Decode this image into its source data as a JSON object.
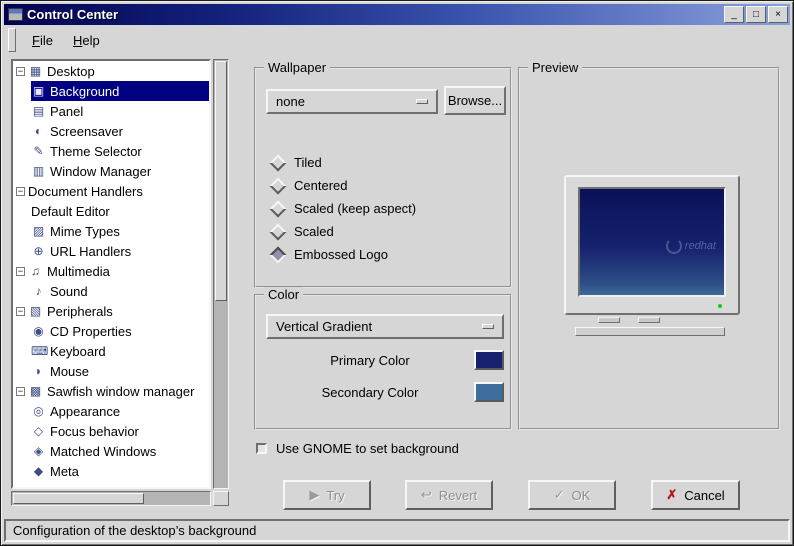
{
  "window": {
    "title": "Control Center",
    "buttons": [
      {
        "name": "minimize",
        "glyph": "_"
      },
      {
        "name": "maximize",
        "glyph": "□"
      },
      {
        "name": "close",
        "glyph": "×"
      }
    ]
  },
  "menubar": {
    "items": [
      {
        "label": "File"
      },
      {
        "label": "Help"
      }
    ]
  },
  "tree": {
    "items": [
      {
        "label": "Desktop",
        "level": 0,
        "expanded": true,
        "glyph": "▦"
      },
      {
        "label": "Background",
        "level": 1,
        "selected": true,
        "glyph": "▣"
      },
      {
        "label": "Panel",
        "level": 1,
        "glyph": "▤"
      },
      {
        "label": "Screensaver",
        "level": 1,
        "glyph": "◐"
      },
      {
        "label": "Theme Selector",
        "level": 1,
        "glyph": "✎"
      },
      {
        "label": "Window Manager",
        "level": 1,
        "glyph": "▥"
      },
      {
        "label": "Document Handlers",
        "level": 0,
        "expanded": true
      },
      {
        "label": "Default Editor",
        "level": 1
      },
      {
        "label": "Mime Types",
        "level": 1,
        "glyph": "▨"
      },
      {
        "label": "URL Handlers",
        "level": 1,
        "glyph": "⊕"
      },
      {
        "label": "Multimedia",
        "level": 0,
        "expanded": true,
        "glyph": "♫"
      },
      {
        "label": "Sound",
        "level": 1,
        "glyph": "♪"
      },
      {
        "label": "Peripherals",
        "level": 0,
        "expanded": true,
        "glyph": "▧"
      },
      {
        "label": "CD Properties",
        "level": 1,
        "glyph": "◉"
      },
      {
        "label": "Keyboard",
        "level": 1,
        "glyph": "⌨"
      },
      {
        "label": "Mouse",
        "level": 1,
        "glyph": "◗"
      },
      {
        "label": "Sawfish window manager",
        "level": 0,
        "expanded": true,
        "glyph": "▩"
      },
      {
        "label": "Appearance",
        "level": 1,
        "glyph": "◎"
      },
      {
        "label": "Focus behavior",
        "level": 1,
        "glyph": "◇"
      },
      {
        "label": "Matched Windows",
        "level": 1,
        "glyph": "◈"
      },
      {
        "label": "Meta",
        "level": 1,
        "glyph": "◆"
      }
    ]
  },
  "wallpaper": {
    "group_title": "Wallpaper",
    "file_dropdown_value": "none",
    "browse_label": "Browse...",
    "options": [
      {
        "label": "Tiled",
        "selected": false
      },
      {
        "label": "Centered",
        "selected": false
      },
      {
        "label": "Scaled (keep aspect)",
        "selected": false
      },
      {
        "label": "Scaled",
        "selected": false
      },
      {
        "label": "Embossed Logo",
        "selected": true
      }
    ]
  },
  "color": {
    "group_title": "Color",
    "gradient_dropdown_value": "Vertical Gradient",
    "primary_label": "Primary Color",
    "primary_color": "#182070",
    "secondary_label": "Secondary Color",
    "secondary_color": "#3e6e9e"
  },
  "preview": {
    "group_title": "Preview",
    "logo_text": "redhat"
  },
  "gnome_checkbox": {
    "label": "Use GNOME to set background",
    "checked": false
  },
  "buttons": {
    "try": {
      "label": "Try",
      "enabled": false,
      "glyph": "▶"
    },
    "revert": {
      "label": "Revert",
      "enabled": false,
      "glyph": "↩"
    },
    "ok": {
      "label": "OK",
      "enabled": false,
      "glyph": "✓"
    },
    "cancel": {
      "label": "Cancel",
      "enabled": true,
      "glyph": "✗"
    }
  },
  "statusbar": {
    "text": "Configuration of the desktop’s background"
  }
}
